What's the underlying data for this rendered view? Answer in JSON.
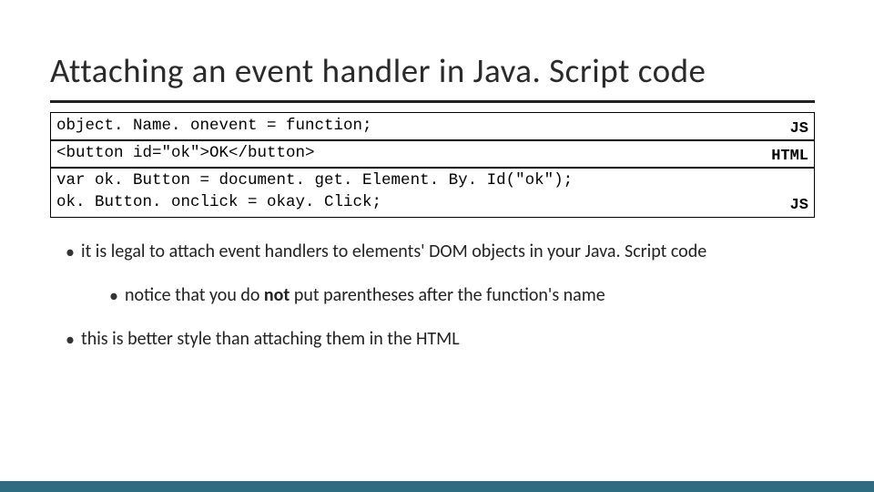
{
  "title": "Attaching an event handler in Java. Script code",
  "code_blocks": [
    {
      "lines": "object. Name. onevent = function;",
      "lang": "JS",
      "tall": false
    },
    {
      "lines": "<button id=\"ok\">OK</button>",
      "lang": "HTML",
      "tall": false
    },
    {
      "lines": "var ok. Button = document. get. Element. By. Id(\"ok\");\nok. Button. onclick = okay. Click;",
      "lang": "JS",
      "tall": true
    }
  ],
  "bullets": {
    "b1": "it is legal to attach event handlers to elements' DOM objects in your Java. Script code",
    "b2_pre": "notice that you do ",
    "b2_bold": "not",
    "b2_post": " put parentheses after the function's name",
    "b3": "this is better style than attaching them in the HTML"
  }
}
